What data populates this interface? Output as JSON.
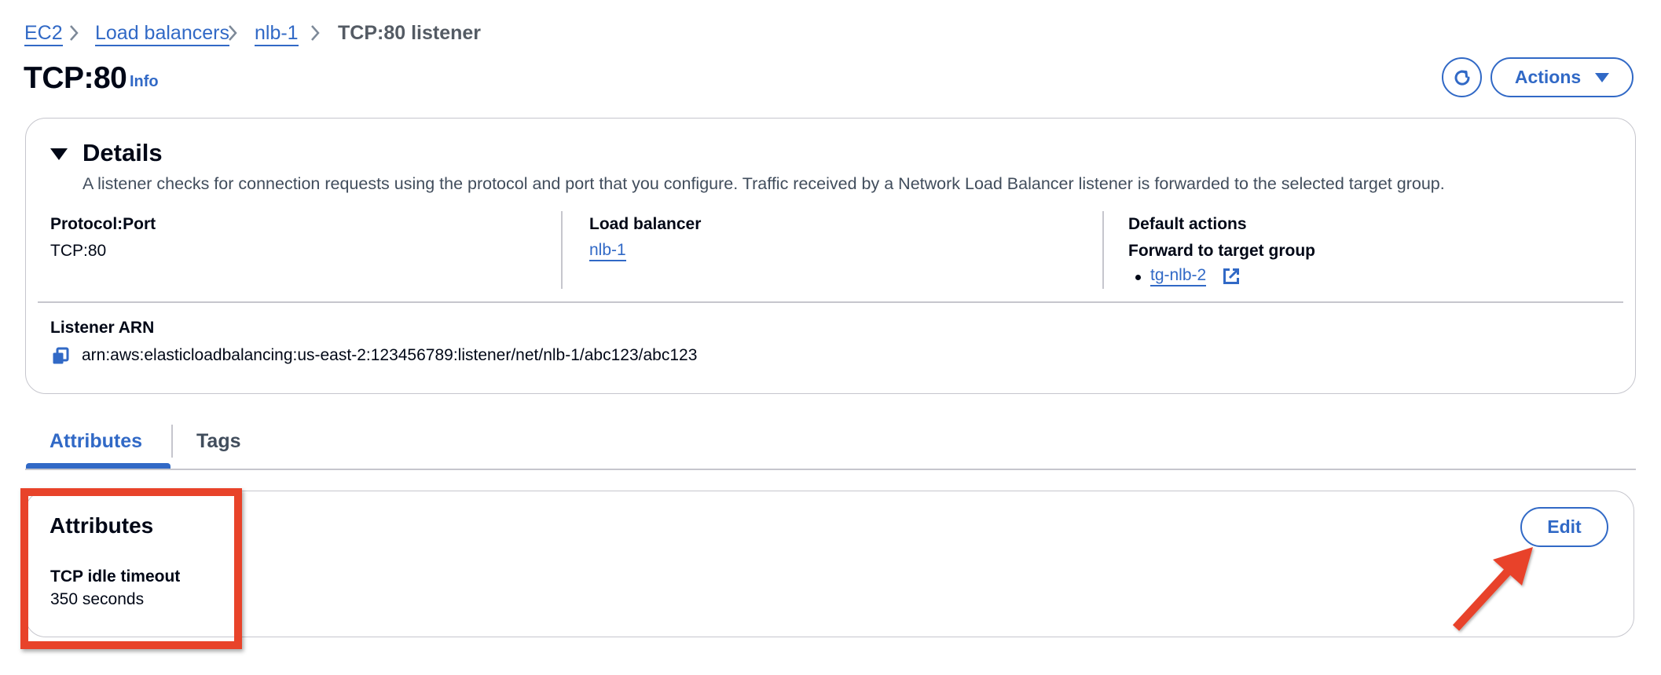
{
  "breadcrumb": {
    "items": [
      {
        "label": "EC2"
      },
      {
        "label": "Load balancers"
      },
      {
        "label": "nlb-1"
      }
    ],
    "current": "TCP:80 listener"
  },
  "header": {
    "title": "TCP:80",
    "info_label": "Info",
    "refresh_icon": "refresh-icon",
    "actions_label": "Actions",
    "actions_icon": "caret-down-icon"
  },
  "details": {
    "heading": "Details",
    "description": "A listener checks for connection requests using the protocol and port that you configure. Traffic received by a Network Load Balancer listener is forwarded to the selected target group.",
    "protocol_port": {
      "label": "Protocol:Port",
      "value": "TCP:80"
    },
    "load_balancer": {
      "label": "Load balancer",
      "value": "nlb-1"
    },
    "default_actions": {
      "label": "Default actions",
      "sub_label": "Forward to target group",
      "target_groups": [
        "tg-nlb-2"
      ]
    },
    "listener_arn": {
      "label": "Listener ARN",
      "value": "arn:aws:elasticloadbalancing:us-east-2:123456789:listener/net/nlb-1/abc123/abc123"
    }
  },
  "tabs": [
    {
      "label": "Attributes",
      "active": true
    },
    {
      "label": "Tags",
      "active": false
    }
  ],
  "attributes": {
    "heading": "Attributes",
    "edit_label": "Edit",
    "items": [
      {
        "label": "TCP idle timeout",
        "value": "350 seconds"
      }
    ]
  },
  "annotation": {
    "highlight_color": "#e8432a",
    "arrow_color": "#e8432a"
  },
  "colors": {
    "link": "#3169c6",
    "text": "#000716",
    "secondary_text": "#414d5c",
    "border": "#c6c6cd"
  }
}
